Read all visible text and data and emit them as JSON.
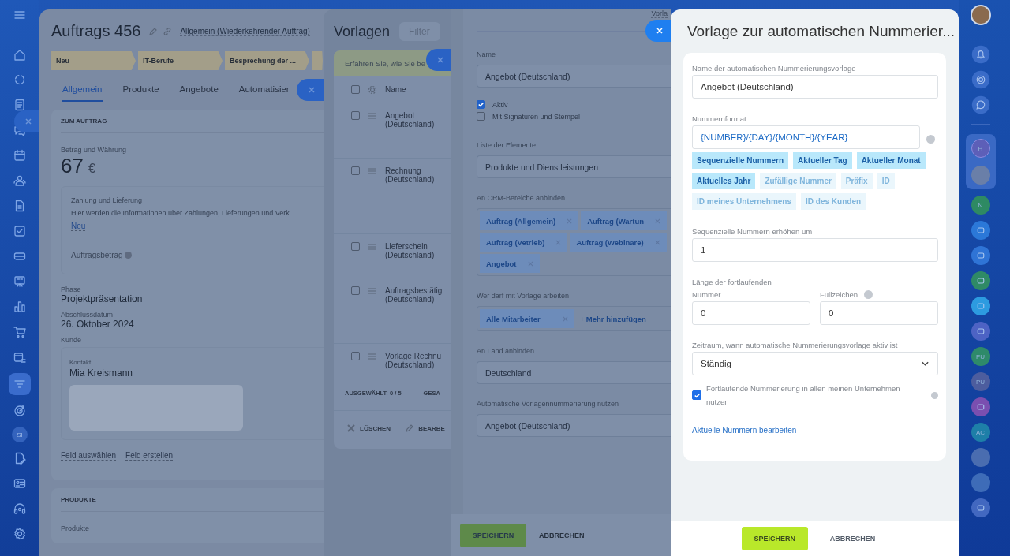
{
  "left_nav": {
    "avatar_initials": "SI"
  },
  "deal": {
    "title": "Auftrags 456",
    "pipeline": "Allgemein (Wiederkehrender Auftrag)",
    "stages": [
      {
        "label": "Neu"
      },
      {
        "label": "IT-Berufe"
      },
      {
        "label": "Besprechung der ..."
      }
    ],
    "tabs": [
      {
        "label": "Allgemein",
        "selected": true
      },
      {
        "label": "Produkte",
        "selected": false
      },
      {
        "label": "Angebote",
        "selected": false
      },
      {
        "label": "Automatisier",
        "selected": false
      }
    ],
    "section_title": "ZUM AUFTRAG",
    "amount_label": "Betrag und Währung",
    "amount": "67",
    "currency": "€",
    "payment_label": "Zahlung und Lieferung",
    "payment_text": "Hier werden die Informationen über Zahlungen, Lieferungen und Verk",
    "payment_link": "Neu",
    "order_amount_label": "Auftragsbetrag",
    "fields": [
      {
        "label": "Phase",
        "value": "Projektpräsentation"
      },
      {
        "label": "Abschlussdatum",
        "value": "26. Oktober 2024"
      }
    ],
    "client_label": "Kunde",
    "contact_label": "Kontakt",
    "contact_name": "Mia Kreismann",
    "links": [
      "Feld auswählen",
      "Feld erstellen"
    ],
    "products_title": "PRODUKTE",
    "products_label": "Produkte"
  },
  "templates": {
    "title": "Vorlagen",
    "filter_placeholder": "Filter",
    "banner": "Erfahren Sie, wie Sie be",
    "column": "Name",
    "rows": [
      {
        "lines": [
          "Angebot",
          "(Deutschland)"
        ],
        "checked": false
      },
      {
        "lines": [
          "Rechnung",
          "(Deutschland)"
        ],
        "checked": false
      },
      {
        "lines": [
          "Lieferschein",
          "(Deutschland)"
        ],
        "checked": false
      },
      {
        "lines": [
          "Auftragsbestätig",
          "(Deutschland)"
        ],
        "checked": false
      },
      {
        "lines": [
          "Vorlage Rechnu",
          "(Deutschland)"
        ],
        "checked": false
      }
    ],
    "header_checked": false,
    "selected_count": "AUSGEWÄHLT: **0 / 5**",
    "total": "GESA",
    "actions": [
      "LÖSCHEN",
      "BEARBE"
    ]
  },
  "template_form": {
    "top_link": "Vorla",
    "name_label": "Name",
    "name_value": "Angebot (Deutschland)",
    "checkboxes": [
      {
        "label": "Aktiv",
        "checked": true
      },
      {
        "label": "Mit Signaturen und Stempel",
        "checked": false
      }
    ],
    "list_label": "Liste der Elemente",
    "list_value": "Produkte und Dienstleistungen",
    "crm_label": "An CRM-Bereiche anbinden",
    "crm_tags": [
      "Auftrag (Allgemein)",
      "Auftrag (Wartun",
      "Auftrag (Vetrieb)",
      "Auftrag (Webinare)",
      "Angebot"
    ],
    "access_label": "Wer darf mit Vorlage arbeiten",
    "access_tags": [
      "Alle Mitarbeiter"
    ],
    "add_more": "+ Mehr hinzufügen",
    "country_label": "An Land anbinden",
    "country_value": "Deutschland",
    "numbering_label": "Automatische Vorlagennummerierung nutzen",
    "numbering_value": "Angebot (Deutschland)",
    "buttons": [
      "SPEICHERN",
      "ABBRECHEN"
    ]
  },
  "numbering_panel": {
    "title": "Vorlage zur automatischen Nummerier...",
    "name_label": "Name der automatischen Nummerierungsvorlage",
    "name_value": "Angebot (Deutschland)",
    "format_label": "Nummernformat",
    "format_value": "{NUMBER}/{DAY}/{MONTH}/{YEAR}",
    "tokens": [
      {
        "label": "Sequenzielle Nummern",
        "selected": true
      },
      {
        "label": "Aktueller Tag",
        "selected": true
      },
      {
        "label": "Aktueller Monat",
        "selected": true
      },
      {
        "label": "Aktuelles Jahr",
        "selected": true
      },
      {
        "label": "Zufällige Nummer",
        "selected": false
      },
      {
        "label": "Präfix",
        "selected": false
      },
      {
        "label": "ID",
        "selected": false
      },
      {
        "label": "ID meines Unternehmens",
        "selected": false
      },
      {
        "label": "ID des Kunden",
        "selected": false
      }
    ],
    "increment_label": "Sequenzielle Nummern erhöhen um",
    "increment_value": "1",
    "length_label": "Länge der fortlaufenden",
    "number_label": "Nummer",
    "number_value": "0",
    "fill_label": "Füllzeichen",
    "fill_value": "0",
    "period_label": "Zeitraum, wann automatische Nummerierungsvorlage aktiv ist",
    "period_value": "Ständig",
    "shared": {
      "label": "Fortlaufende Nummerierung in allen meinen Unternehmen nutzen",
      "checked": true
    },
    "edit_link": "Aktuelle Nummern bearbeiten",
    "buttons": [
      "SPEICHERN",
      "ABBRECHEN"
    ]
  },
  "right_bar": {
    "contacts": [
      {
        "kind": "initials",
        "initials": "H",
        "color": "#5d5fb8"
      },
      {
        "kind": "photo",
        "color": "#6a7fa8"
      },
      {
        "kind": "initials",
        "initials": "N",
        "color": "#2e8a63"
      },
      {
        "kind": "icon",
        "color": "#2b78d8"
      },
      {
        "kind": "icon",
        "color": "#2f74d6"
      },
      {
        "kind": "icon",
        "color": "#2f8a66"
      },
      {
        "kind": "icon",
        "color": "#2d9be0"
      },
      {
        "kind": "icon",
        "color": "#4d63c4"
      },
      {
        "kind": "initials",
        "initials": "PU",
        "color": "#2e8a6a"
      },
      {
        "kind": "initials",
        "initials": "PU",
        "color": "#4d5d9e"
      },
      {
        "kind": "icon",
        "color": "#7a4fb0"
      },
      {
        "kind": "initials",
        "initials": "AC",
        "color": "#1e7fa8"
      },
      {
        "kind": "photo",
        "color": "#4a6db0"
      },
      {
        "kind": "photo",
        "color": "#3e6cb8"
      },
      {
        "kind": "icon",
        "color": "#4268c0"
      }
    ]
  }
}
